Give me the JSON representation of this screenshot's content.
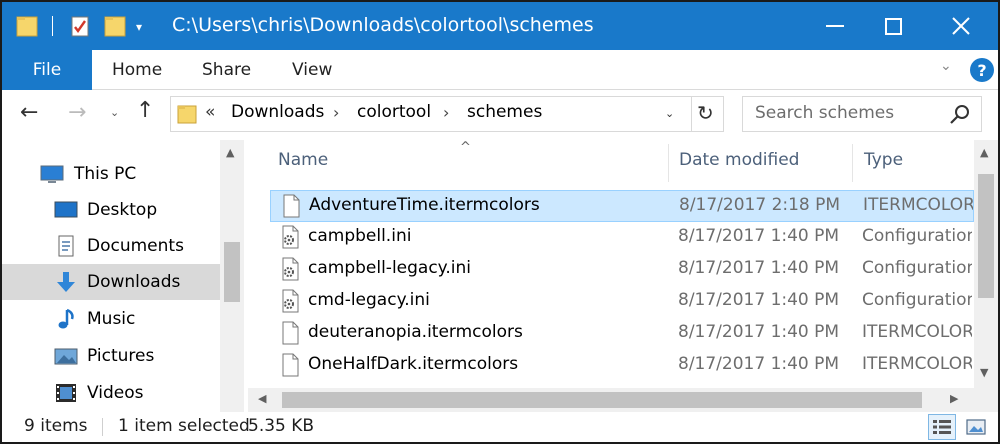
{
  "window": {
    "title": "C:\\Users\\chris\\Downloads\\colortool\\schemes",
    "accent": "#1979ca"
  },
  "ribbon": {
    "tabs": [
      {
        "label": "File"
      },
      {
        "label": "Home"
      },
      {
        "label": "Share"
      },
      {
        "label": "View"
      }
    ],
    "help_label": "?"
  },
  "address": {
    "overflow": "«",
    "crumbs": [
      "Downloads",
      "colortool",
      "schemes"
    ],
    "separator": "›"
  },
  "search": {
    "placeholder": "Search schemes"
  },
  "navpane": {
    "items": [
      {
        "label": "This PC",
        "icon": "computer-icon",
        "selected": false
      },
      {
        "label": "Desktop",
        "icon": "desktop-icon",
        "selected": false
      },
      {
        "label": "Documents",
        "icon": "documents-icon",
        "selected": false
      },
      {
        "label": "Downloads",
        "icon": "download-arrow-icon",
        "selected": true
      },
      {
        "label": "Music",
        "icon": "music-note-icon",
        "selected": false
      },
      {
        "label": "Pictures",
        "icon": "pictures-icon",
        "selected": false
      },
      {
        "label": "Videos",
        "icon": "film-icon",
        "selected": false
      }
    ]
  },
  "filelist": {
    "columns": [
      {
        "label": "Name"
      },
      {
        "label": "Date modified"
      },
      {
        "label": "Type"
      }
    ],
    "rows": [
      {
        "name": "AdventureTime.itermcolors",
        "date": "8/17/2017 2:18 PM",
        "type": "ITERMCOLORS",
        "icon": "blank-file-icon",
        "selected": true
      },
      {
        "name": "campbell.ini",
        "date": "8/17/2017 1:40 PM",
        "type": "Configuration",
        "icon": "config-file-icon",
        "selected": false
      },
      {
        "name": "campbell-legacy.ini",
        "date": "8/17/2017 1:40 PM",
        "type": "Configuration",
        "icon": "config-file-icon",
        "selected": false
      },
      {
        "name": "cmd-legacy.ini",
        "date": "8/17/2017 1:40 PM",
        "type": "Configuration",
        "icon": "config-file-icon",
        "selected": false
      },
      {
        "name": "deuteranopia.itermcolors",
        "date": "8/17/2017 1:40 PM",
        "type": "ITERMCOLORS",
        "icon": "blank-file-icon",
        "selected": false
      },
      {
        "name": "OneHalfDark.itermcolors",
        "date": "8/17/2017 1:40 PM",
        "type": "ITERMCOLORS",
        "icon": "blank-file-icon",
        "selected": false
      }
    ]
  },
  "status": {
    "item_count": "9 items",
    "selection": "1 item selected",
    "size": "5.35 KB"
  }
}
